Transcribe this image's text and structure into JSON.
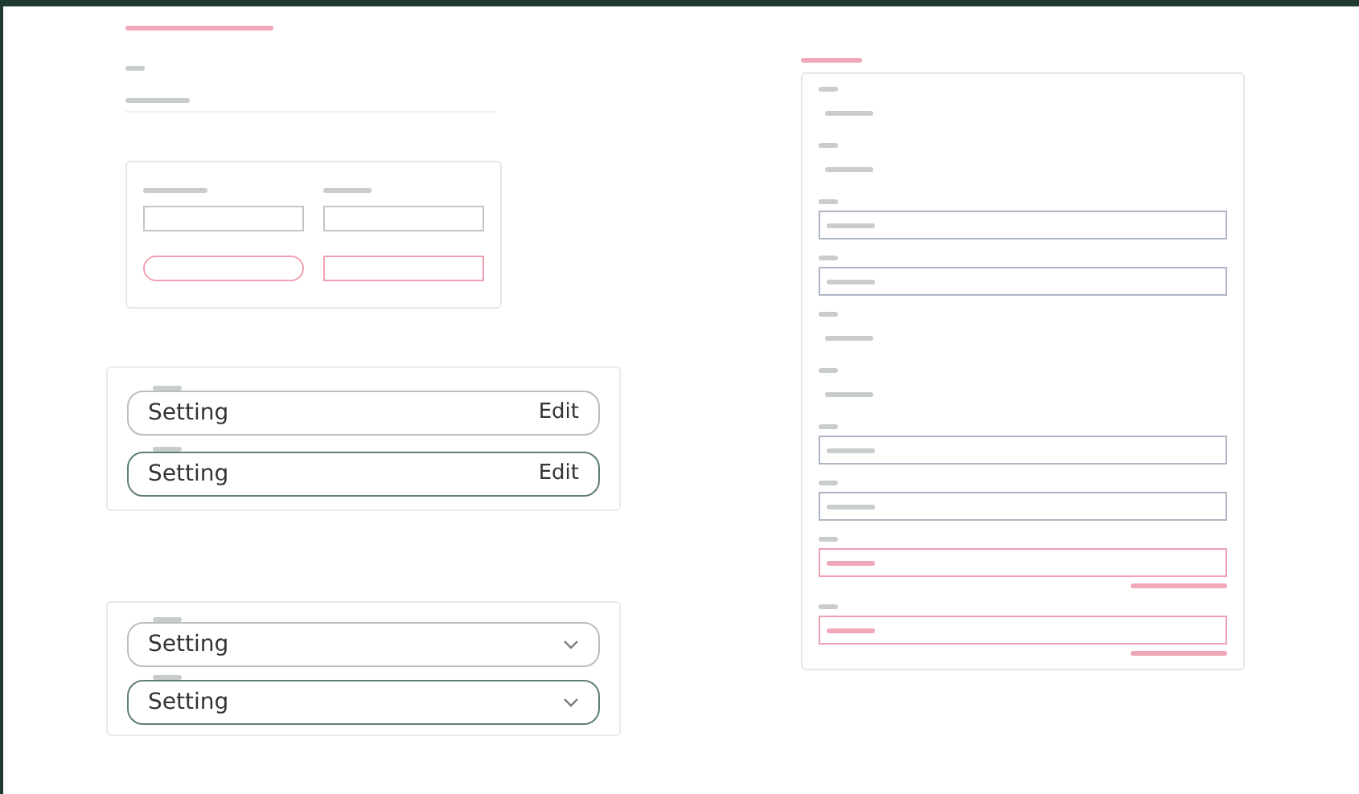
{
  "outlined_fields": [
    {
      "value": "Setting",
      "action": "Edit",
      "focused": false
    },
    {
      "value": "Setting",
      "action": "Edit",
      "focused": true
    }
  ],
  "select_fields": [
    {
      "value": "Setting",
      "focused": false
    },
    {
      "value": "Setting",
      "focused": true
    }
  ],
  "form_rows": [
    {
      "kind": "square",
      "error": false
    },
    {
      "kind": "rounded",
      "error": true
    }
  ],
  "side_fields": [
    {
      "kind": "plain",
      "error": false
    },
    {
      "kind": "plain",
      "error": false
    },
    {
      "kind": "outlined",
      "error": false
    },
    {
      "kind": "outlined",
      "error": false
    },
    {
      "kind": "plain",
      "error": false
    },
    {
      "kind": "plain",
      "error": false
    },
    {
      "kind": "outlined",
      "error": false
    },
    {
      "kind": "outlined",
      "error": false
    },
    {
      "kind": "outlined",
      "error": true
    },
    {
      "kind": "outlined",
      "error": true
    }
  ]
}
